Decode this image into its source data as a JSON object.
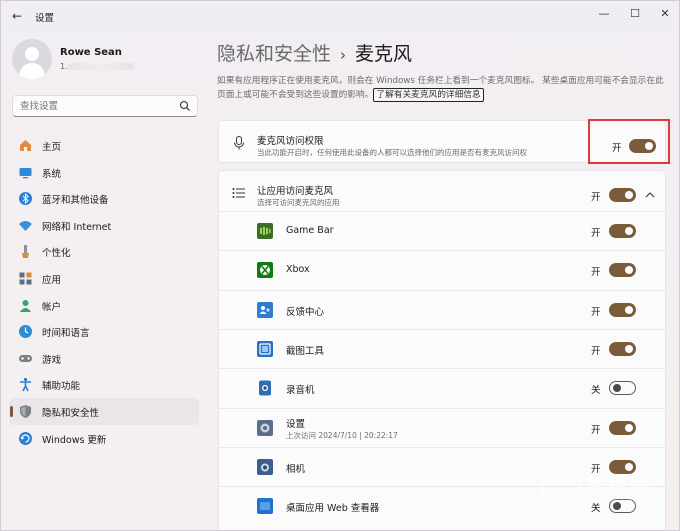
{
  "window": {
    "title": "设置"
  },
  "window_controls": {
    "minimize": "—",
    "maximize": "☐",
    "close": "✕"
  },
  "profile": {
    "name": "Rowe Sean",
    "sub": "1."
  },
  "search": {
    "placeholder": "查找设置"
  },
  "nav": [
    {
      "label": "主页",
      "icon": "home-icon",
      "color": "#e88b3a"
    },
    {
      "label": "系统",
      "icon": "system-icon",
      "color": "#2f8bd6"
    },
    {
      "label": "蓝牙和其他设备",
      "icon": "bluetooth-icon",
      "color": "#2a7fd4"
    },
    {
      "label": "网络和 Internet",
      "icon": "wifi-icon",
      "color": "#3a8fd9"
    },
    {
      "label": "个性化",
      "icon": "personalization-icon",
      "color": "#d98b3a"
    },
    {
      "label": "应用",
      "icon": "apps-icon",
      "color": "#5e6e85"
    },
    {
      "label": "帐户",
      "icon": "account-icon",
      "color": "#2fa86a"
    },
    {
      "label": "时间和语言",
      "icon": "time-language-icon",
      "color": "#2f8bd6"
    },
    {
      "label": "游戏",
      "icon": "gaming-icon",
      "color": "#7a7f86"
    },
    {
      "label": "辅助功能",
      "icon": "accessibility-icon",
      "color": "#2a7fd4"
    },
    {
      "label": "隐私和安全性",
      "icon": "shield-icon",
      "color": "#7b8089",
      "active": true
    },
    {
      "label": "Windows 更新",
      "icon": "update-icon",
      "color": "#2a7fd4"
    }
  ],
  "breadcrumb": {
    "parent": "隐私和安全性",
    "separator": "›",
    "current": "麦克风"
  },
  "description": {
    "text": "如果有应用程序正在使用麦克风，则会在 Windows 任务栏上看到一个麦克风图标。 某些桌面应用可能不会显示在此页面上或可能不会受到这些设置的影响。",
    "link": "了解有关麦克风的详细信息"
  },
  "mic_access": {
    "title": "麦克风访问权限",
    "subtitle": "当此功能开启时，任何使用此设备的人都可以选择他们的应用是否有麦克风访问权",
    "state": "开",
    "on": true
  },
  "app_access": {
    "title": "让应用访问麦克风",
    "subtitle": "选择可访问麦克风的应用",
    "state": "开",
    "on": true
  },
  "apps": [
    {
      "name": "Game Bar",
      "state": "开",
      "on": true,
      "icon": "gamebar-icon",
      "color": "#3a6e2a"
    },
    {
      "name": "Xbox",
      "state": "开",
      "on": true,
      "icon": "xbox-icon",
      "color": "#107c10"
    },
    {
      "name": "反馈中心",
      "state": "开",
      "on": true,
      "icon": "feedback-hub-icon",
      "color": "#2f7bd6"
    },
    {
      "name": "截图工具",
      "state": "开",
      "on": true,
      "icon": "snipping-tool-icon",
      "color": "#2a6fc9"
    },
    {
      "name": "录音机",
      "state": "关",
      "on": false,
      "icon": "recorder-icon",
      "color": "#2f6fb8"
    },
    {
      "name": "设置",
      "subtitle": "上次访问 2024/7/10 | 20:22:17",
      "state": "开",
      "on": true,
      "icon": "settings-app-icon",
      "color": "#5a6e8a"
    },
    {
      "name": "相机",
      "state": "开",
      "on": true,
      "icon": "camera-icon",
      "color": "#3a5f8f"
    },
    {
      "name": "桌面应用 Web 查看器",
      "state": "关",
      "on": false,
      "icon": "webview-icon",
      "color": "#1f72d4"
    }
  ],
  "watermark": {
    "text": "路由器",
    "sub": "luyouqi.com"
  }
}
